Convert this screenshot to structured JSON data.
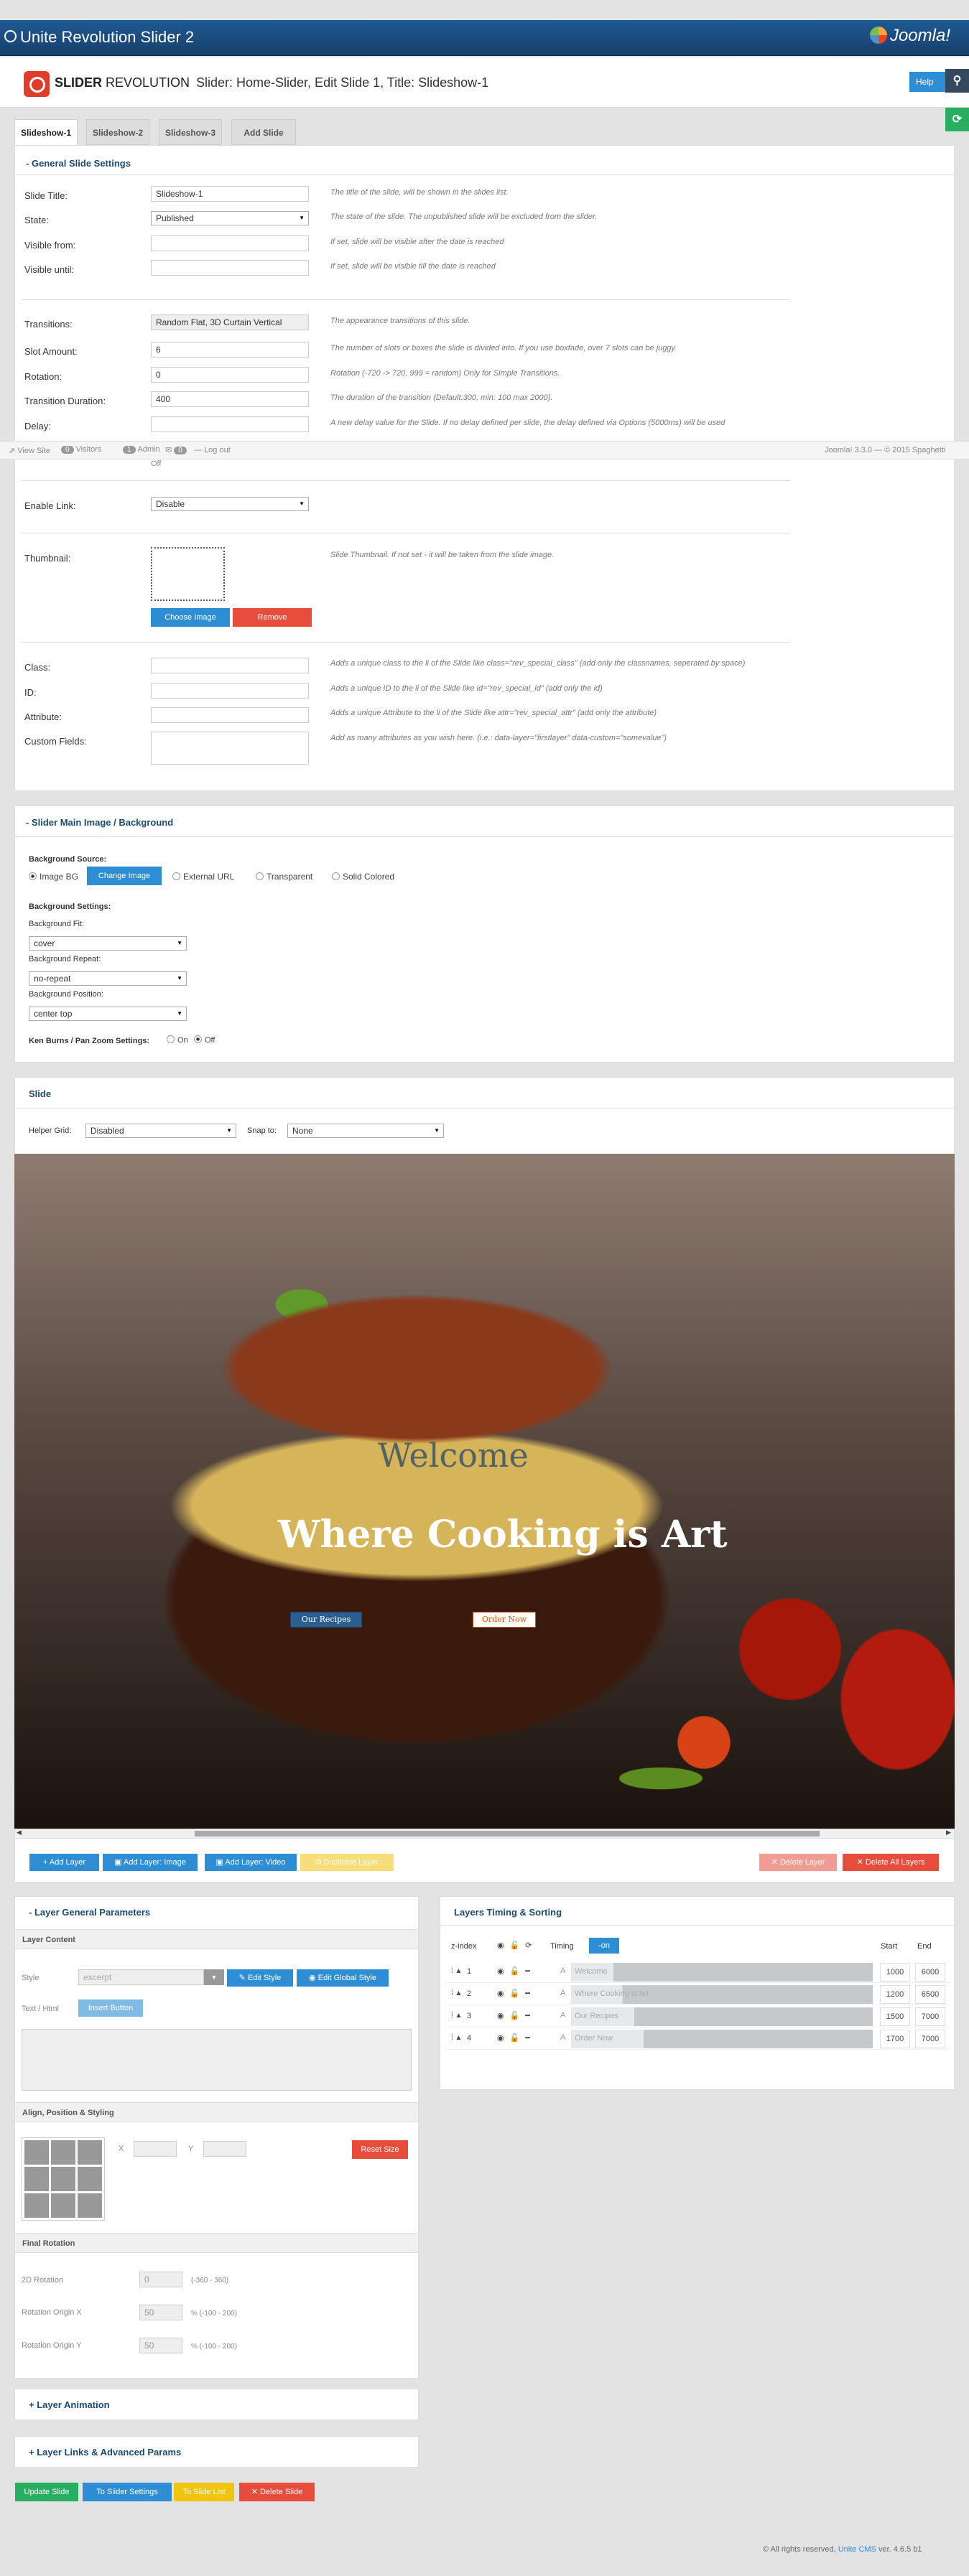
{
  "app_title": "Unite Revolution Slider 2",
  "joomla_logo": "Joomla!",
  "header": {
    "brand_bold": "SLIDER",
    "brand_rest": "REVOLUTION",
    "title": "Slider: Home-Slider, Edit Slide 1, Title: Slideshow-1",
    "help": "Help"
  },
  "tabs": [
    "Slideshow-1",
    "Slideshow-2",
    "Slideshow-3",
    "Add Slide"
  ],
  "general": {
    "title": "General Slide Settings",
    "slide_title_label": "Slide Title:",
    "slide_title_value": "Slideshow-1",
    "slide_title_hint": "The title of the slide, will be shown in the slides list.",
    "state_label": "State:",
    "state_value": "Published",
    "state_hint": "The state of the slide. The unpublished slide will be excluded from the slider.",
    "visible_from_label": "Visible from:",
    "visible_from_hint": "If set, slide will be visible after the date is reached",
    "visible_until_label": "Visible until:",
    "visible_until_hint": "If set, slide will be visible till the date is reached",
    "transitions_label": "Transitions:",
    "transitions_value": "Random Flat, 3D Curtain Vertical",
    "transitions_hint": "The appearance transitions of this slide.",
    "slot_label": "Slot Amount:",
    "slot_value": "6",
    "slot_hint": "The number of slots or boxes the slide is divided into. If you use boxfade, over 7 slots can be juggy.",
    "rotation_label": "Rotation:",
    "rotation_value": "0",
    "rotation_hint": "Rotation (-720 -> 720, 999 = random) Only for Simple Transitions.",
    "duration_label": "Transition Duration:",
    "duration_value": "400",
    "duration_hint": "The duration of the transition (Default:300, min: 100 max 2000).",
    "delay_label": "Delay:",
    "delay_hint": "A new delay value for the Slide. If no delay defined per slide, the delay defined via Options (5000ms) will be used",
    "off_text": "Off",
    "enable_link_label": "Enable Link:",
    "enable_link_value": "Disable",
    "thumbnail_label": "Thumbnail:",
    "thumbnail_hint": "Slide Thumbnail. If not set - it will be taken from the slide image.",
    "choose_image": "Choose Image",
    "remove": "Remove",
    "class_label": "Class:",
    "class_hint": "Adds a unique class to the li of the Slide like class=\"rev_special_class\" (add only the classnames, seperated by space)",
    "id_label": "ID:",
    "id_hint": "Adds a unique ID to the li of the Slide like id=\"rev_special_id\" (add only the id)",
    "attribute_label": "Attribute:",
    "attribute_hint": "Adds a unique Attribute to the li of the Slide like attr=\"rev_special_attr\" (add only the attribute)",
    "custom_label": "Custom Fields:",
    "custom_hint": "Add as many attributes as you wish here. (i.e.: data-layer=\"firstlayer\" data-custom=\"somevalue\")"
  },
  "statusbar": {
    "view_site": "View Site",
    "visitors_count": "0",
    "visitors": "Visitors",
    "admin_count": "1",
    "admin": "Admin",
    "msg_count": "0",
    "logout": "Log out",
    "version": "Joomla! 3.3.0 — © 2015 Spaghetti"
  },
  "background": {
    "title": "Slider Main Image / Background",
    "source_label": "Background Source:",
    "opt_image": "Image BG",
    "change_image": "Change Image",
    "opt_external": "External URL",
    "opt_transparent": "Transparent",
    "opt_solid": "Solid Colored",
    "settings_label": "Background Settings:",
    "fit_label": "Background Fit:",
    "fit_value": "cover",
    "repeat_label": "Background Repeat:",
    "repeat_value": "no-repeat",
    "position_label": "Background Position:",
    "position_value": "center top",
    "kenburns_label": "Ken Burns / Pan Zoom Settings:",
    "on": "On",
    "off": "Off"
  },
  "slide": {
    "title": "Slide",
    "helper_grid_label": "Helper Grid:",
    "helper_grid_value": "Disabled",
    "snap_label": "Snap to:",
    "snap_value": "None",
    "layer_welcome": "Welcome",
    "layer_heading": "Where Cooking is Art",
    "layer_btn1": "Our Recipes",
    "layer_btn2": "Order Now",
    "add_layer": "Add Layer",
    "add_layer_image": "Add Layer: Image",
    "add_layer_video": "Add Layer: Video",
    "duplicate_layer": "Duplicate Layer",
    "delete_layer": "Delete Layer",
    "delete_all": "Delete All Layers"
  },
  "layer_params": {
    "title": "Layer General Parameters",
    "content": "Layer Content",
    "style_label": "Style",
    "style_value": "excerpt",
    "edit_style": "Edit Style",
    "edit_global_style": "Edit Global Style",
    "text_label": "Text / Html",
    "insert_button": "Insert Button",
    "align_title": "Align, Position & Styling",
    "x_label": "X",
    "y_label": "Y",
    "reset_size": "Reset Size",
    "final_rotation": "Final Rotation",
    "rot2d_label": "2D Rotation",
    "rot2d_value": "0",
    "rot2d_range": "(-360 - 360)",
    "originx_label": "Rotation Origin X",
    "originx_value": "50",
    "originx_range": "% (-100 - 200)",
    "originy_label": "Rotation Origin Y",
    "originy_value": "50",
    "originy_range": "% (-100 - 200)"
  },
  "layer_animation": "Layer Animation",
  "layer_links": "Layer Links & Advanced Params",
  "timing": {
    "title": "Layers Timing & Sorting",
    "zindex": "z-index",
    "timing": "Timing",
    "toggle": "on",
    "start": "Start",
    "end": "End",
    "rows": [
      {
        "n": "1",
        "name": "Welcome",
        "start": "1000",
        "end": "6000",
        "fill": 0.14
      },
      {
        "n": "2",
        "name": "Where Cooking is Art",
        "start": "1200",
        "end": "6500",
        "fill": 0.17
      },
      {
        "n": "3",
        "name": "Our Recipes",
        "start": "1500",
        "end": "7000",
        "fill": 0.21
      },
      {
        "n": "4",
        "name": "Order Now",
        "start": "1700",
        "end": "7000",
        "fill": 0.24
      }
    ]
  },
  "bottom_buttons": {
    "update": "Update Slide",
    "to_settings": "To Slider Settings",
    "to_list": "To Slide List",
    "delete": "Delete Slide"
  },
  "footer": {
    "copyright": "© All rights reserved,",
    "link": "Unite CMS",
    "version": "ver. 4.6.5 b1"
  }
}
